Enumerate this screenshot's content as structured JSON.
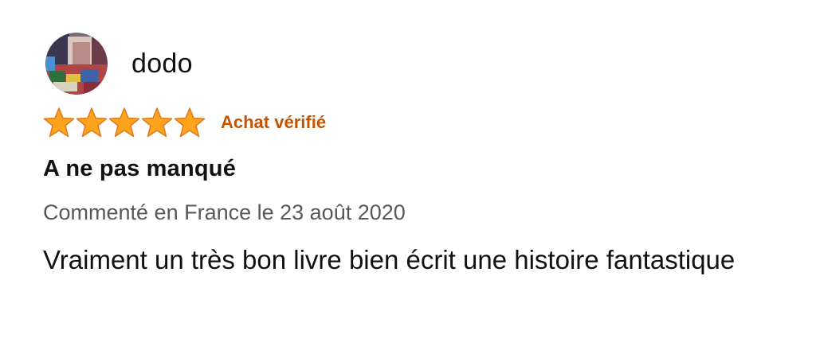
{
  "review": {
    "author": "dodo",
    "rating": 5,
    "rating_max": 5,
    "verified_label": "Achat vérifié",
    "title": "A ne pas manqué",
    "meta": "Commenté en France le 23 août 2020",
    "body": "Vraiment un très bon livre bien écrit une histoire fantastique"
  },
  "colors": {
    "star_fill": "#FFA41C",
    "star_stroke": "#DE7921",
    "verified": "#C45500",
    "meta": "#565959",
    "text": "#111111"
  },
  "icons": {
    "avatar": "avatar-photo",
    "star": "star-icon"
  }
}
